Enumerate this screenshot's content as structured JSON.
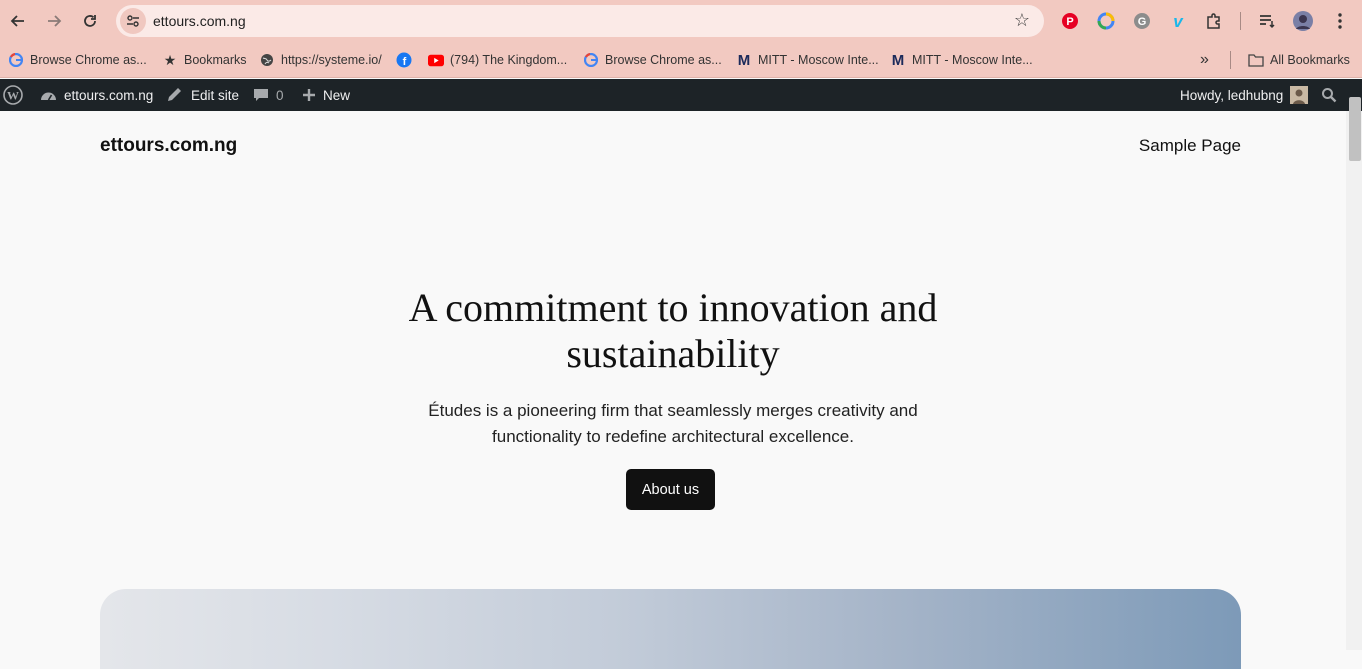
{
  "browser": {
    "url": "ettours.com.ng",
    "bookmarks": [
      {
        "label": "Browse Chrome as...",
        "icon": "google-icon"
      },
      {
        "label": "Bookmarks",
        "icon": "star-icon"
      },
      {
        "label": "https://systeme.io/",
        "icon": "globe-icon"
      },
      {
        "label": "",
        "icon": "facebook-icon"
      },
      {
        "label": "(794) The Kingdom...",
        "icon": "youtube-icon"
      },
      {
        "label": "Browse Chrome as...",
        "icon": "google-icon"
      },
      {
        "label": "MITT - Moscow Inte...",
        "icon": "mitt-icon"
      },
      {
        "label": "MITT - Moscow Inte...",
        "icon": "mitt-icon"
      }
    ],
    "all_bookmarks": "All Bookmarks",
    "more_glyph": "»"
  },
  "wp_admin_bar": {
    "site_name": "ettours.com.ng",
    "edit_site": "Edit site",
    "comments_count": "0",
    "new_label": "New",
    "greeting": "Howdy, ledhubng"
  },
  "site": {
    "title": "ettours.com.ng",
    "nav": "Sample Page"
  },
  "hero": {
    "title_line1": "A commitment to innovation and",
    "title_line2": "sustainability",
    "desc_line1": "Études is a pioneering firm that seamlessly merges creativity and",
    "desc_line2": "functionality to redefine architectural excellence.",
    "cta": "About us"
  },
  "colors": {
    "chrome_bg": "#f2c9c1",
    "admin_bar": "#1d2327",
    "button": "#111111"
  }
}
